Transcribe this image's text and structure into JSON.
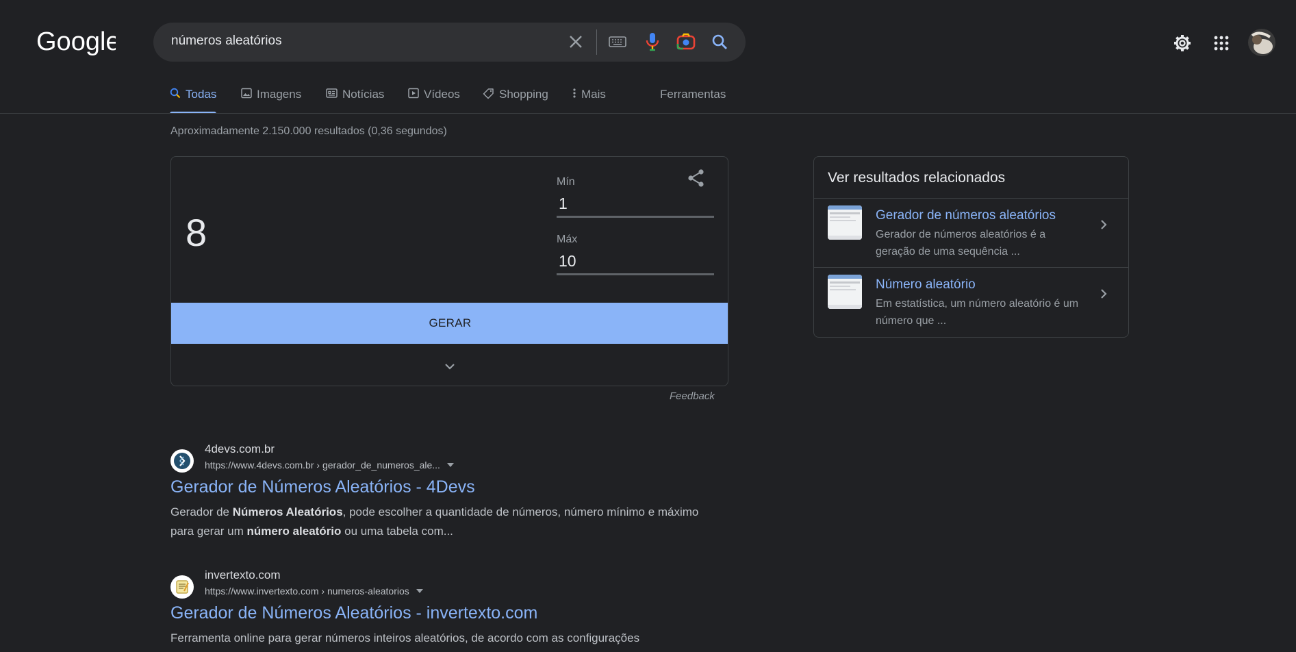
{
  "header": {
    "logo_text": "Google",
    "search_value": "números aleatórios"
  },
  "tabs": [
    {
      "label": "Todas"
    },
    {
      "label": "Imagens"
    },
    {
      "label": "Notícias"
    },
    {
      "label": "Vídeos"
    },
    {
      "label": "Shopping"
    },
    {
      "label": "Mais"
    },
    {
      "label": "Ferramentas"
    }
  ],
  "result_stats": "Aproximadamente 2.150.000 resultados (0,36 segundos)",
  "rng": {
    "result": "8",
    "min_label": "Mín",
    "min_value": "1",
    "max_label": "Máx",
    "max_value": "10",
    "button_label": "GERAR",
    "feedback": "Feedback"
  },
  "results": [
    {
      "site": "4devs.com.br",
      "url": "https://www.4devs.com.br › gerador_de_numeros_ale...",
      "title": "Gerador de Números Aleatórios - 4Devs",
      "snippet_html": "Gerador de <b>Números Aleatórios</b>, pode escolher a quantidade de números, número mínimo e máximo para gerar um <b>número aleatório</b> ou uma tabela com..."
    },
    {
      "site": "invertexto.com",
      "url": "https://www.invertexto.com › numeros-aleatorios",
      "title": "Gerador de Números Aleatórios - invertexto.com",
      "snippet_html": "Ferramenta online para gerar números inteiros aleatórios, de acordo com as configurações"
    }
  ],
  "related": {
    "title": "Ver resultados relacionados",
    "items": [
      {
        "name": "Gerador de números aleatórios",
        "desc": "Gerador de números aleatórios é a geração de uma sequência ..."
      },
      {
        "name": "Número aleatório",
        "desc": "Em estatística, um número aleatório é um número que ..."
      }
    ]
  },
  "colors": {
    "background": "#202124",
    "link": "#8ab4f8",
    "button": "#8ab4f8"
  }
}
